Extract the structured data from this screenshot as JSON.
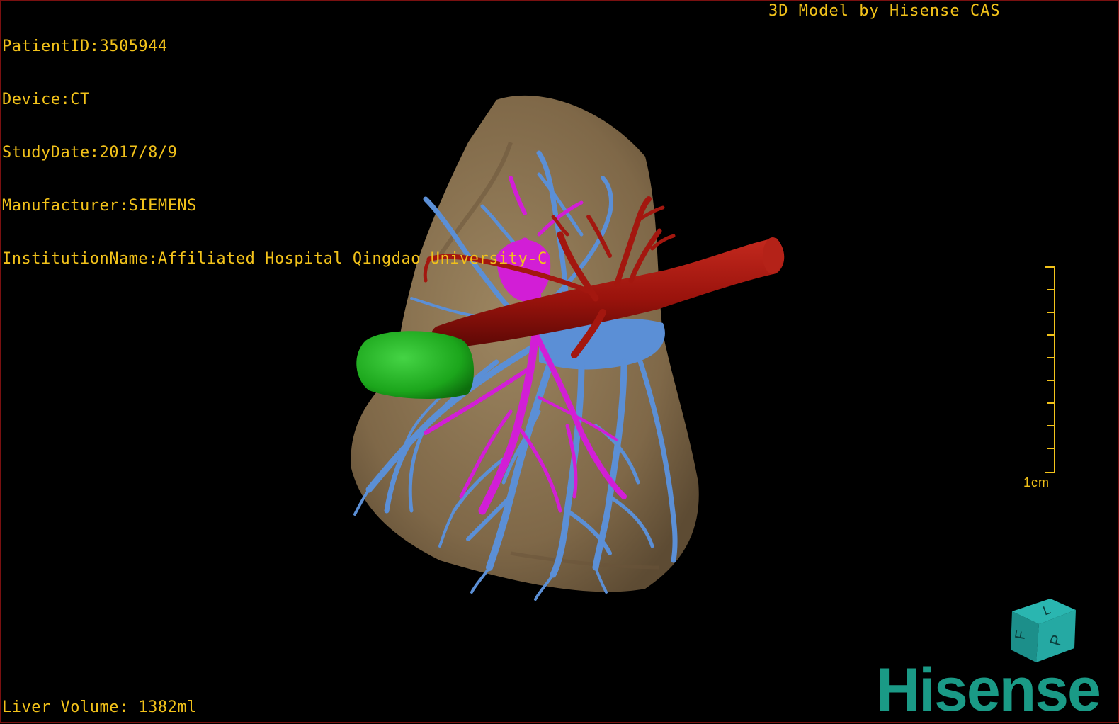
{
  "overlay": {
    "patient_id": "PatientID:3505944",
    "device": "Device:CT",
    "study_date": "StudyDate:2017/8/9",
    "manufacturer": "Manufacturer:SIEMENS",
    "institution": "InstitutionName:Affiliated Hospital Qingdao University-C",
    "brand_caption": "3D Model by Hisense CAS",
    "liver_volume": "Liver Volume: 1382ml"
  },
  "scale": {
    "label": "1cm"
  },
  "orientation_cube": {
    "face_labels": [
      "F",
      "L",
      "P"
    ]
  },
  "logo": {
    "text": "Hisense"
  },
  "colors": {
    "overlay_text": "#f2c21a",
    "liver": "#8a7250",
    "portal_vein": "#5b8fd6",
    "hepatic_vein": "#d21ed6",
    "artery": "#a3170f",
    "gallbladder": "#21b321",
    "logo": "#1a9a86"
  }
}
